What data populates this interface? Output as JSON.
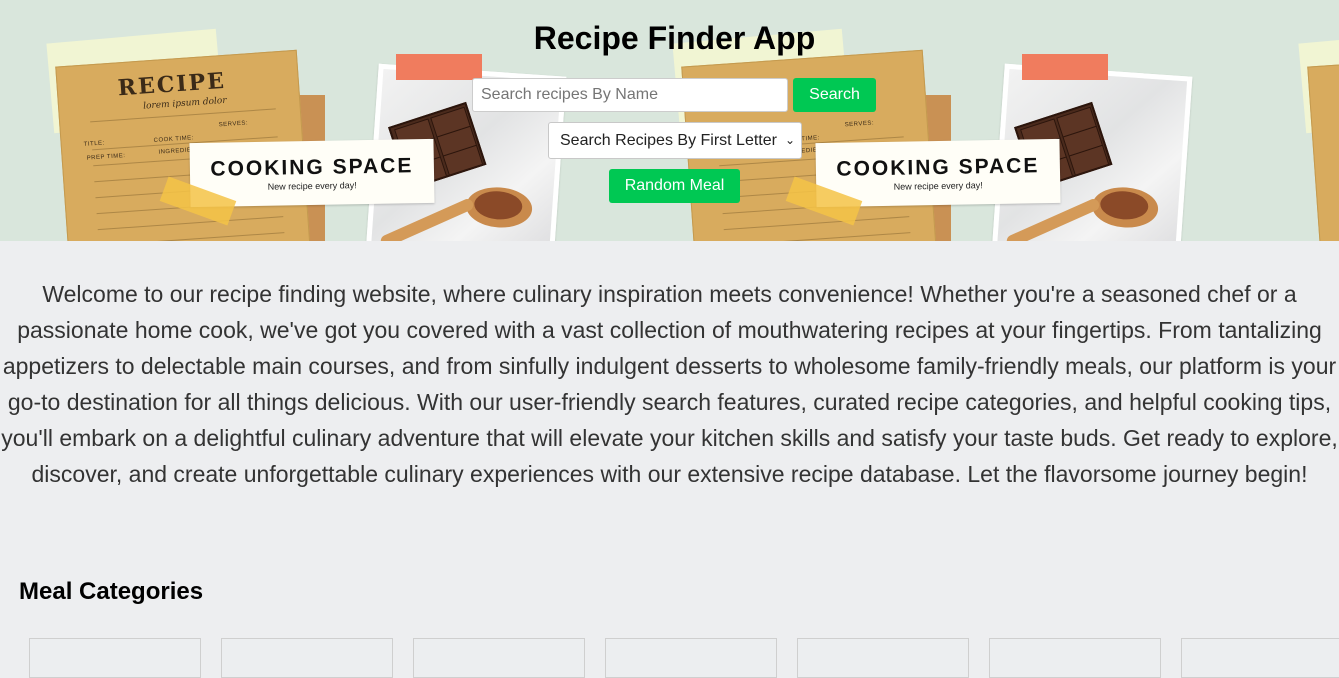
{
  "app": {
    "title": "Recipe Finder App"
  },
  "hero": {
    "card_title": "RECIPE",
    "card_subtitle": "lorem ipsum dolor",
    "card_fields": [
      "TITLE:",
      "PREP TIME:",
      "COOK TIME:",
      "SERVES:",
      "INGREDIENTS:"
    ],
    "banner_title": "COOKING SPACE",
    "banner_tagline": "New recipe every day!"
  },
  "search": {
    "placeholder": "Search recipes By Name",
    "value": "",
    "button_label": "Search"
  },
  "letter_filter": {
    "selected": "Search Recipes By First Letter"
  },
  "random": {
    "button_label": "Random Meal"
  },
  "intro": {
    "text": "Welcome to our recipe finding website, where culinary inspiration meets convenience! Whether you're a seasoned chef or a passionate home cook, we've got you covered with a vast collection of mouthwatering recipes at your fingertips. From tantalizing appetizers to delectable main courses, and from sinfully indulgent desserts to wholesome family-friendly meals, our platform is your go-to destination for all things delicious. With our user-friendly search features, curated recipe categories, and helpful cooking tips, you'll embark on a delightful culinary adventure that will elevate your kitchen skills and satisfy your taste buds. Get ready to explore, discover, and create unforgettable culinary experiences with our extensive recipe database. Let the flavorsome journey begin!"
  },
  "categories": {
    "heading": "Meal Categories"
  },
  "colors": {
    "accent": "#00c853",
    "hero_bg": "#d9e6dc",
    "page_bg": "#edeef0"
  }
}
